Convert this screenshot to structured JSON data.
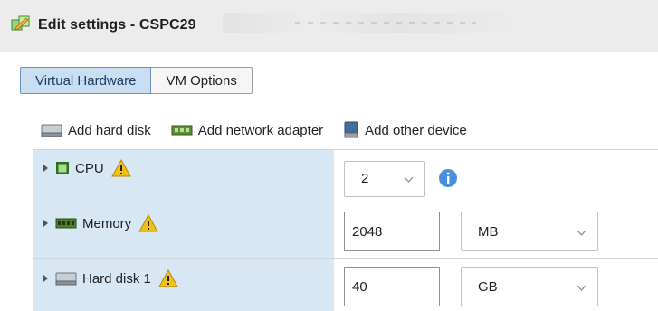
{
  "window": {
    "title": "Edit settings - CSPC29",
    "icon": "edit-vm-icon"
  },
  "tabs": [
    {
      "label": "Virtual Hardware",
      "active": true
    },
    {
      "label": "VM Options",
      "active": false
    }
  ],
  "toolbar": {
    "add_hard_disk": "Add hard disk",
    "add_network_adapter": "Add network adapter",
    "add_other_device": "Add other device"
  },
  "rows": {
    "cpu": {
      "label": "CPU",
      "value": "2",
      "icon": "cpu-icon",
      "warning": true,
      "info": true
    },
    "memory": {
      "label": "Memory",
      "value": "2048",
      "unit": "MB",
      "icon": "memory-icon",
      "warning": true
    },
    "hard_disk": {
      "label": "Hard disk 1",
      "value": "40",
      "unit": "GB",
      "icon": "hard-disk-icon",
      "warning": true
    }
  },
  "colors": {
    "active_tab": "#c9dff1",
    "label_column": "#d7e7f4",
    "warning": "#f2c118",
    "info": "#4a90d9"
  }
}
